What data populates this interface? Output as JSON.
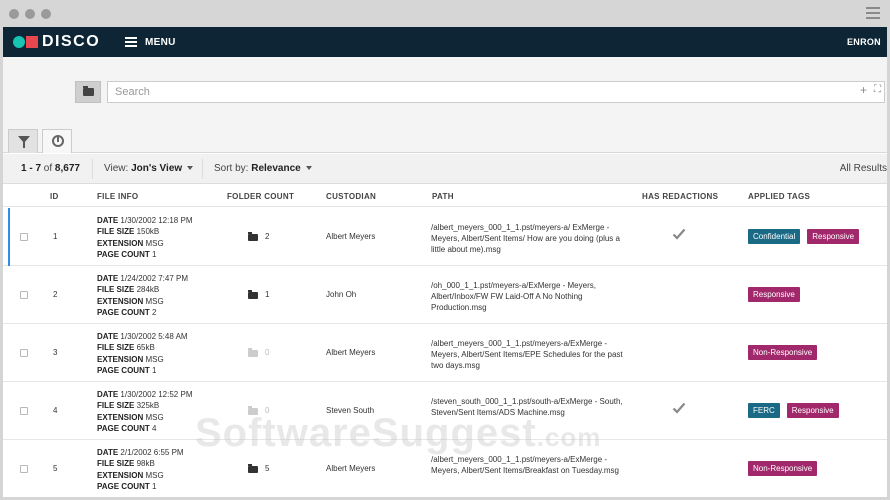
{
  "navbar": {
    "brand": "DISCO",
    "menu_label": "MENU",
    "workspace": "ENRON",
    "brand_colors": {
      "teal": "#17c3b2",
      "red": "#e8474f",
      "bar": "#0d2535"
    }
  },
  "search": {
    "placeholder": "Search",
    "add_symbol": "+",
    "tree_symbol": "⛶"
  },
  "tabs": [
    {
      "icon": "filter-icon"
    },
    {
      "icon": "pie-chart-icon"
    }
  ],
  "toolbar": {
    "range": "1 - 7",
    "of_label": "of",
    "total": "8,677",
    "view_label": "View:",
    "view_value": "Jon's View",
    "sort_label": "Sort by:",
    "sort_value": "Relevance",
    "all_results": "All Results"
  },
  "columns": {
    "id": "ID",
    "file_info": "FILE INFO",
    "folder_count": "FOLDER COUNT",
    "custodian": "CUSTODIAN",
    "path": "PATH",
    "has_redactions": "HAS REDACTIONS",
    "applied_tags": "APPLIED TAGS"
  },
  "labels": {
    "date": "DATE",
    "file_size": "FILE SIZE",
    "extension": "EXTENSION",
    "page_count": "PAGE COUNT"
  },
  "rows": [
    {
      "id": "1",
      "date": "1/30/2002 12:18 PM",
      "file_size": "150kB",
      "extension": "MSG",
      "page_count": "1",
      "folder_count": "2",
      "custodian": "Albert Meyers",
      "path": "/albert_meyers_000_1_1.pst/meyers-a/ ExMerge - Meyers, Albert/Sent Items/ How are you doing (plus a little about me).msg",
      "redacted": true,
      "tags": [
        "Confidential",
        "Responsive"
      ]
    },
    {
      "id": "2",
      "date": "1/24/2002 7:47 PM",
      "file_size": "284kB",
      "extension": "MSG",
      "page_count": "2",
      "folder_count": "1",
      "custodian": "John Oh",
      "path": "/oh_000_1_1.pst/meyers-a/ExMerge - Meyers, Albert/Inbox/FW FW Laid-Off A No Nothing Production.msg",
      "redacted": false,
      "tags": [
        "Responsive"
      ]
    },
    {
      "id": "3",
      "date": "1/30/2002 5:48 AM",
      "file_size": "65kB",
      "extension": "MSG",
      "page_count": "1",
      "folder_count": "0",
      "custodian": "Albert Meyers",
      "path": "/albert_meyers_000_1_1.pst/meyers-a/ExMerge - Meyers, Albert/Sent Items/EPE Schedules for the past two days.msg",
      "redacted": false,
      "tags": [
        "Non-Responsive"
      ]
    },
    {
      "id": "4",
      "date": "1/30/2002 12:52 PM",
      "file_size": "325kB",
      "extension": "MSG",
      "page_count": "4",
      "folder_count": "0",
      "custodian": "Steven South",
      "path": "/steven_south_000_1_1.pst/south-a/ExMerge - South, Steven/Sent Items/ADS Machine.msg",
      "redacted": true,
      "tags": [
        "FERC",
        "Responsive"
      ]
    },
    {
      "id": "5",
      "date": "2/1/2002 6:55 PM",
      "file_size": "98kB",
      "extension": "MSG",
      "page_count": "1",
      "folder_count": "5",
      "custodian": "Albert Meyers",
      "path": "/albert_meyers_000_1_1.pst/meyers-a/ExMerge - Meyers, Albert/Sent Items/Breakfast on Tuesday.msg",
      "redacted": false,
      "tags": [
        "Non-Responsive"
      ]
    }
  ],
  "watermark": {
    "main": "SoftwareSuggest",
    "suffix": ".com"
  }
}
